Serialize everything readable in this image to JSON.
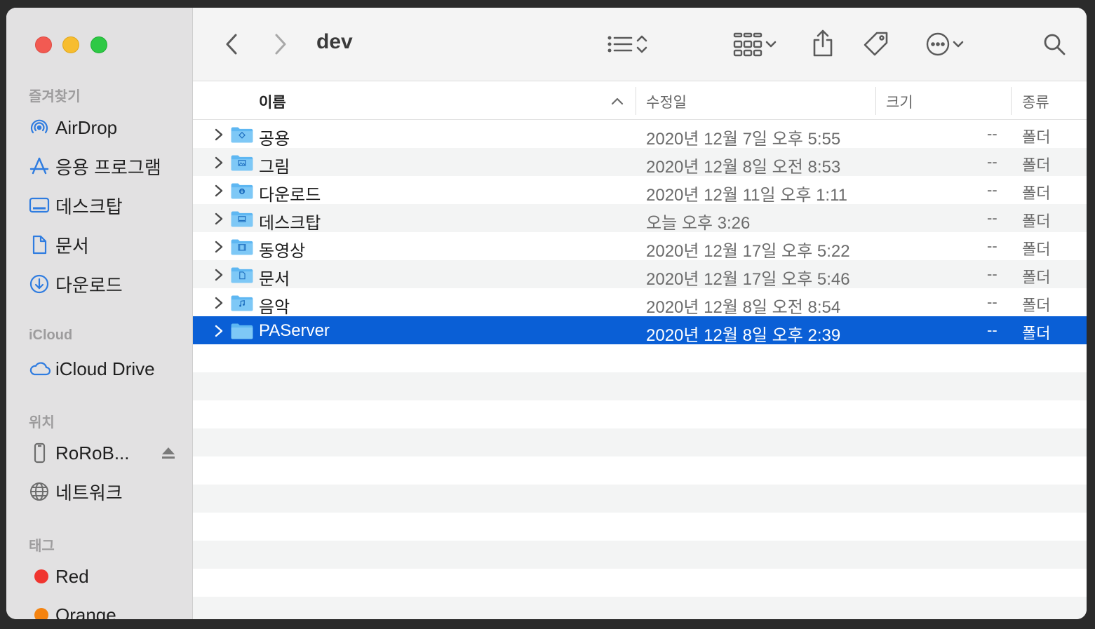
{
  "window": {
    "title": "dev"
  },
  "sidebar": {
    "favorites_title": "즐겨찾기",
    "favorites": [
      {
        "label": "AirDrop",
        "icon": "airdrop-icon"
      },
      {
        "label": "응용 프로그램",
        "icon": "applications-icon"
      },
      {
        "label": "데스크탑",
        "icon": "desktop-icon"
      },
      {
        "label": "문서",
        "icon": "document-icon"
      },
      {
        "label": "다운로드",
        "icon": "download-icon"
      }
    ],
    "icloud_title": "iCloud",
    "icloud": [
      {
        "label": "iCloud Drive",
        "icon": "cloud-icon"
      }
    ],
    "locations_title": "위치",
    "locations": [
      {
        "label": "RoRoB...",
        "icon": "phone-icon"
      },
      {
        "label": "네트워크",
        "icon": "globe-icon"
      }
    ],
    "tags_title": "태그",
    "tags": [
      {
        "label": "Red",
        "color": "#f0352f"
      },
      {
        "label": "Orange",
        "color": "#f5830f"
      }
    ]
  },
  "columns": {
    "name": "이름",
    "modified": "수정일",
    "size": "크기",
    "kind": "종류"
  },
  "files": [
    {
      "name": "공용",
      "modified": "2020년 12월 7일 오후 5:55",
      "size": "--",
      "kind": "폴더",
      "glyph": "public"
    },
    {
      "name": "그림",
      "modified": "2020년 12월 8일 오전 8:53",
      "size": "--",
      "kind": "폴더",
      "glyph": "pictures"
    },
    {
      "name": "다운로드",
      "modified": "2020년 12월 11일 오후 1:11",
      "size": "--",
      "kind": "폴더",
      "glyph": "downloads"
    },
    {
      "name": "데스크탑",
      "modified": "오늘 오후 3:26",
      "size": "--",
      "kind": "폴더",
      "glyph": "desktop"
    },
    {
      "name": "동영상",
      "modified": "2020년 12월 17일 오후 5:22",
      "size": "--",
      "kind": "폴더",
      "glyph": "movies"
    },
    {
      "name": "문서",
      "modified": "2020년 12월 17일 오후 5:46",
      "size": "--",
      "kind": "폴더",
      "glyph": "documents"
    },
    {
      "name": "음악",
      "modified": "2020년 12월 8일 오전 8:54",
      "size": "--",
      "kind": "폴더",
      "glyph": "music"
    },
    {
      "name": "PAServer",
      "modified": "2020년 12월 8일 오후 2:39",
      "size": "--",
      "kind": "폴더",
      "glyph": "plain",
      "selected": true
    }
  ],
  "colors": {
    "selection": "#0a5fd6",
    "accent": "#2f7ce0"
  }
}
